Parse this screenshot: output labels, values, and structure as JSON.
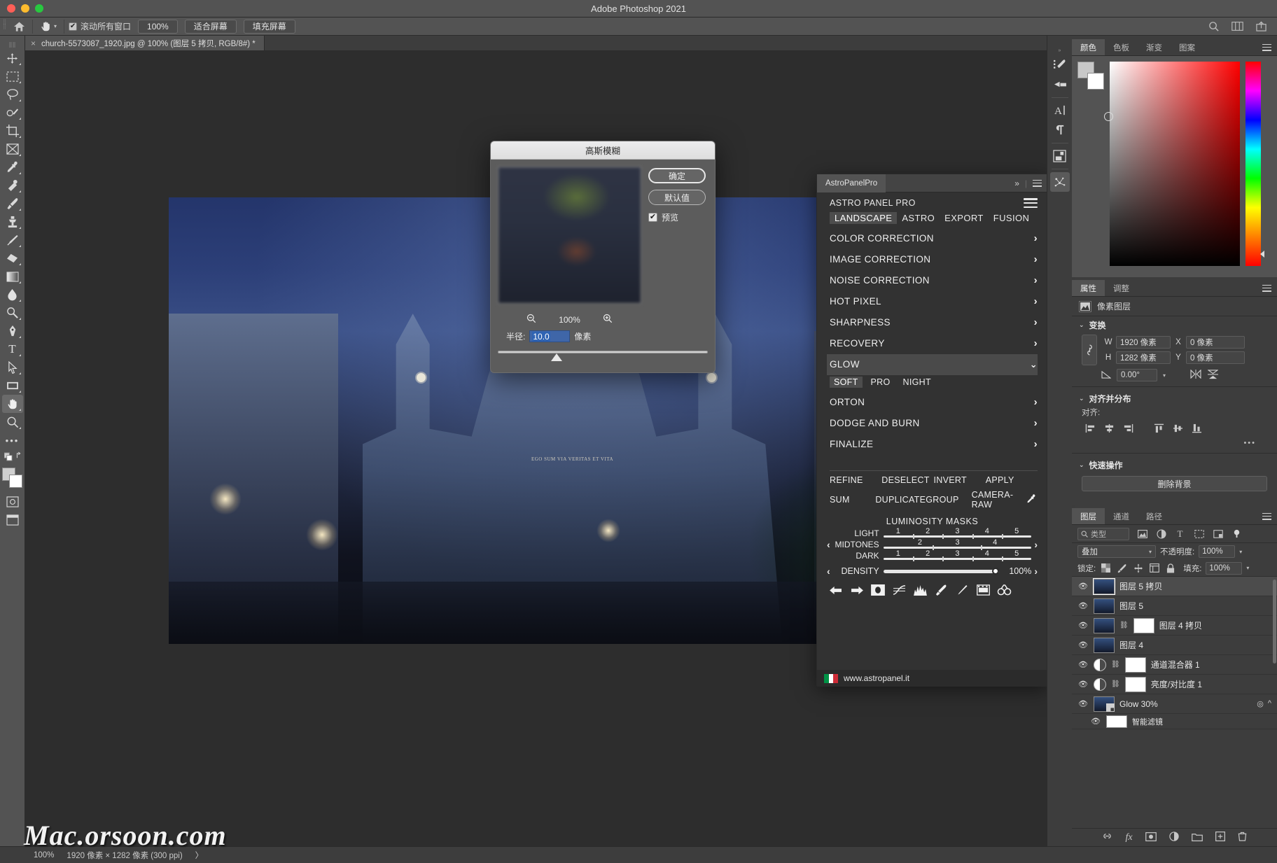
{
  "window": {
    "title": "Adobe Photoshop 2021",
    "traffic_lights": [
      "close-red",
      "minimize-yellow",
      "maximize-green"
    ]
  },
  "options_bar": {
    "home_icon": "home-icon",
    "tool_icon": "hand-tool-icon",
    "tool_dropdown": "chevron-down-icon",
    "scroll_all_windows": {
      "label": "滚动所有窗口",
      "checked": true
    },
    "buttons": [
      "100%",
      "适合屏幕",
      "填充屏幕"
    ],
    "right_icons": [
      "search-icon",
      "workspace-icon",
      "share-icon"
    ]
  },
  "document_tab": {
    "close": "×",
    "title": "church-5573087_1920.jpg @ 100% (图层 5 拷贝, RGB/8#) *"
  },
  "toolbar": {
    "tools": [
      {
        "name": "move-tool",
        "glyph": "✥"
      },
      {
        "name": "rectangular-marquee-tool",
        "glyph": "▭"
      },
      {
        "name": "lasso-tool",
        "glyph": "◯"
      },
      {
        "name": "quick-selection-tool",
        "glyph": "❀"
      },
      {
        "name": "crop-tool",
        "glyph": "⌗"
      },
      {
        "name": "frame-tool",
        "glyph": "⊠"
      },
      {
        "name": "eyedropper-tool",
        "glyph": "⚲"
      },
      {
        "name": "spot-healing-brush-tool",
        "glyph": "❖"
      },
      {
        "name": "brush-tool",
        "glyph": "✎"
      },
      {
        "name": "clone-stamp-tool",
        "glyph": "⎈"
      },
      {
        "name": "history-brush-tool",
        "glyph": "✧"
      },
      {
        "name": "eraser-tool",
        "glyph": "◣"
      },
      {
        "name": "gradient-tool",
        "glyph": "▤"
      },
      {
        "name": "blur-tool",
        "glyph": "💧"
      },
      {
        "name": "dodge-tool",
        "glyph": "⌕"
      },
      {
        "name": "pen-tool",
        "glyph": "✒"
      },
      {
        "name": "type-tool",
        "glyph": "T"
      },
      {
        "name": "path-selection-tool",
        "glyph": "➤"
      },
      {
        "name": "rectangle-tool",
        "glyph": "▬"
      },
      {
        "name": "hand-tool",
        "glyph": "✋",
        "selected": true
      },
      {
        "name": "zoom-tool",
        "glyph": "🔍"
      },
      {
        "name": "edit-toolbar-more",
        "glyph": "•••"
      }
    ],
    "quick_mask_icon": "quick-mask-icon",
    "screen_mode_icon": "screen-mode-icon",
    "foreground_color": "#d0d0d0",
    "background_color": "#ffffff"
  },
  "gaussian_blur_dialog": {
    "title": "高斯模糊",
    "ok_label": "确定",
    "default_label": "默认值",
    "preview": {
      "label": "预览",
      "checked": true
    },
    "zoom_out_icon": "zoom-out-icon",
    "zoom_in_icon": "zoom-in-icon",
    "zoom_level": "100%",
    "radius_label": "半径:",
    "radius_value": "10.0",
    "radius_unit": "像素"
  },
  "astro_panel": {
    "tab_label": "AstroPanelPro",
    "collapse_icon": "chevron-double-right-icon",
    "menu_icon": "panel-menu-icon",
    "heading": "ASTRO PANEL PRO",
    "hamburger_icon": "hamburger-menu-icon",
    "tabs": [
      {
        "label": "LANDSCAPE",
        "active": true
      },
      {
        "label": "ASTRO",
        "active": false
      },
      {
        "label": "EXPORT",
        "active": false
      },
      {
        "label": "FUSION",
        "active": false
      }
    ],
    "sections": [
      {
        "label": "COLOR CORRECTION",
        "open": false
      },
      {
        "label": "IMAGE CORRECTION",
        "open": false
      },
      {
        "label": "NOISE CORRECTION",
        "open": false
      },
      {
        "label": "HOT PIXEL",
        "open": false
      },
      {
        "label": "SHARPNESS",
        "open": false
      },
      {
        "label": "RECOVERY",
        "open": false
      },
      {
        "label": "GLOW",
        "open": true
      }
    ],
    "glow_modes": [
      {
        "label": "SOFT",
        "active": true
      },
      {
        "label": "PRO",
        "active": false
      },
      {
        "label": "NIGHT",
        "active": false
      }
    ],
    "sections_after": [
      {
        "label": "ORTON"
      },
      {
        "label": "DODGE AND BURN"
      },
      {
        "label": "FINALIZE"
      }
    ],
    "action_row_1": [
      "REFINE",
      "DESELECT",
      "INVERT",
      "APPLY"
    ],
    "action_row_2": [
      "SUM",
      "DUPLICATE",
      "GROUP",
      "CAMERA-RAW"
    ],
    "eyedropper_icon": "eyedropper-icon",
    "luminosity": {
      "title": "LUMINOSITY MASKS",
      "prev_icon": "chevron-left-icon",
      "next_icon": "chevron-right-icon",
      "rows": [
        {
          "label": "LIGHT",
          "ticks": [
            "1",
            "2",
            "3",
            "4",
            "5"
          ]
        },
        {
          "label": "MIDTONES",
          "ticks": [
            "2",
            "3",
            "4"
          ]
        },
        {
          "label": "DARK",
          "ticks": [
            "1",
            "2",
            "3",
            "4",
            "5"
          ]
        }
      ]
    },
    "density": {
      "label": "DENSITY",
      "value": "100%",
      "prev_icon": "chevron-left-icon",
      "next_icon": "chevron-right-icon"
    },
    "bottom_icons": [
      "undo-arrow-icon",
      "redo-arrow-icon",
      "mask-icon",
      "curves-icon",
      "histogram-icon",
      "brush-icon",
      "thin-brush-icon",
      "filmstrip-icon",
      "compare-icon"
    ],
    "footer": {
      "flag": "italy-flag-icon",
      "url": "www.astropanel.it"
    }
  },
  "right_rail": {
    "icons": [
      "brush-presets-icon",
      "tool-presets-icon",
      "character-icon",
      "paragraph-icon",
      "layer-comps-icon",
      "astro-panel-icon"
    ]
  },
  "color_panel": {
    "tabs": [
      {
        "label": "颜色",
        "active": true
      },
      {
        "label": "色板",
        "active": false
      },
      {
        "label": "渐变",
        "active": false
      },
      {
        "label": "图案",
        "active": false
      }
    ],
    "menu_icon": "panel-menu-icon",
    "foreground": "#c8c8c8",
    "background": "#ffffff",
    "field_icon": "color-field",
    "hue_strip_icon": "hue-strip"
  },
  "properties_panel": {
    "tabs": [
      {
        "label": "属性",
        "active": true
      },
      {
        "label": "调整",
        "active": false
      }
    ],
    "menu_icon": "panel-menu-icon",
    "layer_type": {
      "icon": "pixel-layer-icon",
      "label": "像素图层"
    },
    "transform": {
      "title": "变换",
      "link_icon": "link-icon",
      "w_label": "W",
      "w_value": "1920 像素",
      "x_label": "X",
      "x_value": "0 像素",
      "h_label": "H",
      "h_value": "1282 像素",
      "y_label": "Y",
      "y_value": "0 像素",
      "angle_icon": "angle-icon",
      "angle_value": "0.00°",
      "flip_h_icon": "flip-horizontal-icon",
      "flip_v_icon": "flip-vertical-icon"
    },
    "align": {
      "title": "对齐并分布",
      "subtitle": "对齐:",
      "icons": [
        "align-left-icon",
        "align-center-h-icon",
        "align-right-icon",
        "align-top-icon",
        "align-middle-v-icon",
        "align-bottom-icon"
      ],
      "more": "•••"
    },
    "quick_actions": {
      "title": "快速操作",
      "button": "删除背景"
    }
  },
  "layers_panel": {
    "tabs": [
      {
        "label": "图层",
        "active": true
      },
      {
        "label": "通道",
        "active": false
      },
      {
        "label": "路径",
        "active": false
      }
    ],
    "menu_icon": "panel-menu-icon",
    "filter": {
      "search_placeholder": "类型",
      "search_icon": "search-icon",
      "icons": [
        "filter-pixel-icon",
        "filter-adjustment-icon",
        "filter-type-icon",
        "filter-shape-icon",
        "filter-smart-icon"
      ],
      "toggle_icon": "filter-toggle-icon"
    },
    "blend_mode": "叠加",
    "opacity_label": "不透明度:",
    "opacity_value": "100%",
    "lock_label": "锁定:",
    "lock_icons": [
      "lock-transparent-icon",
      "lock-image-icon",
      "lock-position-icon",
      "lock-artboard-icon",
      "lock-all-icon"
    ],
    "fill_label": "填充:",
    "fill_value": "100%",
    "layers": [
      {
        "name": "图层 5 拷贝",
        "visible": true,
        "selected": true,
        "kind": "pixel"
      },
      {
        "name": "图层 5",
        "visible": true,
        "selected": false,
        "kind": "pixel"
      },
      {
        "name": "图层 4 拷贝",
        "visible": true,
        "selected": false,
        "kind": "pixel-masked"
      },
      {
        "name": "图层 4",
        "visible": true,
        "selected": false,
        "kind": "pixel"
      },
      {
        "name": "通道混合器 1",
        "visible": true,
        "selected": false,
        "kind": "adjustment"
      },
      {
        "name": "亮度/对比度 1",
        "visible": true,
        "selected": false,
        "kind": "adjustment"
      },
      {
        "name": "Glow 30%",
        "visible": true,
        "selected": false,
        "kind": "smart"
      },
      {
        "name": "智能滤镜",
        "visible": true,
        "selected": false,
        "kind": "smart-filter"
      }
    ],
    "footer_icons": [
      "link-layers-icon",
      "fx-icon",
      "add-mask-icon",
      "new-adjustment-icon",
      "new-group-icon",
      "new-layer-icon",
      "delete-layer-icon"
    ]
  },
  "status_bar": {
    "zoom": "100%",
    "dimensions": "1920 像素 × 1282 像素 (300 ppi)",
    "chevron": "〉"
  },
  "watermark": "Mac.orsoon.com"
}
